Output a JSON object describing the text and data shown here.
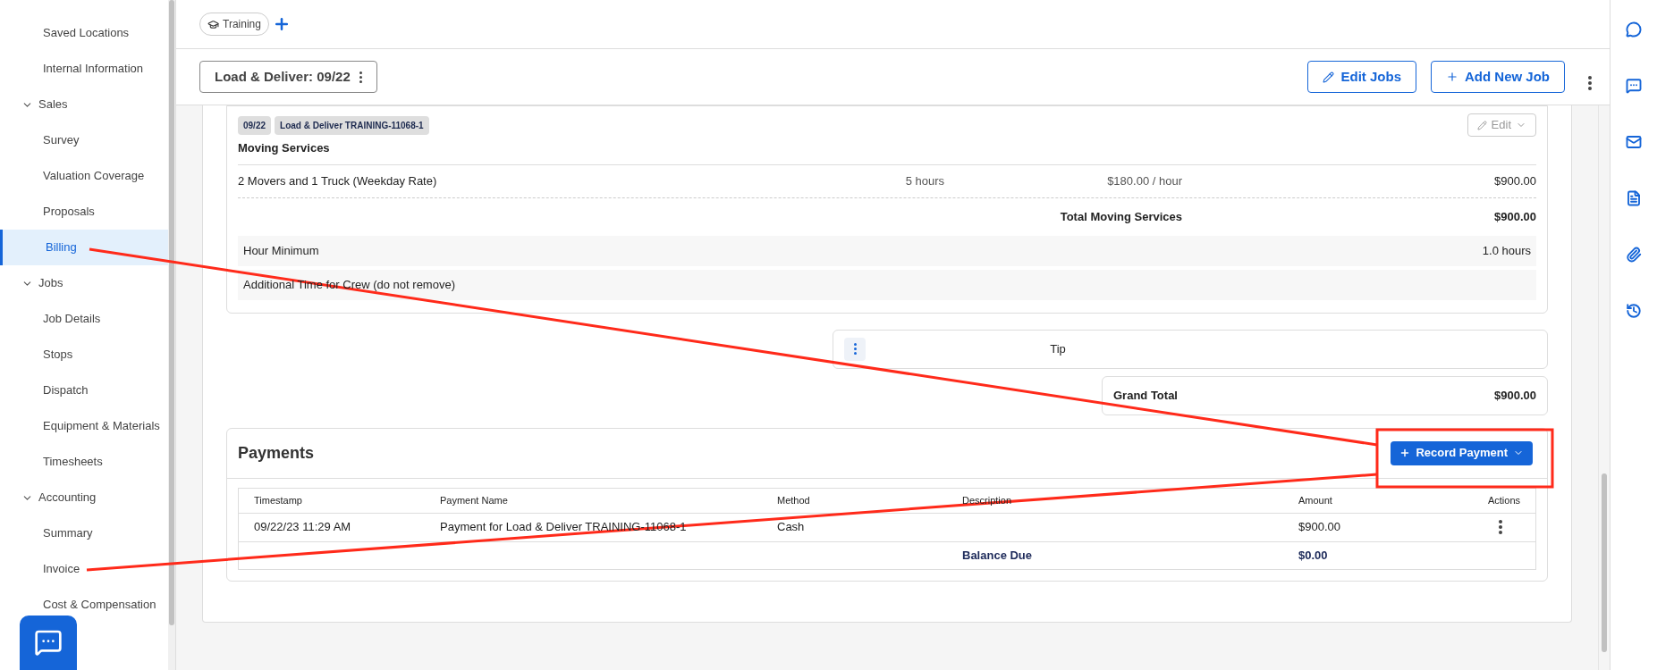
{
  "sidebar": {
    "items": [
      {
        "label": "Saved Locations",
        "selected": false
      },
      {
        "label": "Internal Information",
        "selected": false
      },
      {
        "label": "Sales",
        "expanded": true,
        "selected": false,
        "children": [
          {
            "label": "Survey",
            "selected": false
          },
          {
            "label": "Valuation Coverage",
            "selected": false
          },
          {
            "label": "Proposals",
            "selected": false
          },
          {
            "label": "Billing",
            "selected": true
          }
        ]
      },
      {
        "label": "Jobs",
        "expanded": true,
        "selected": false,
        "children": [
          {
            "label": "Job Details",
            "selected": false
          },
          {
            "label": "Stops",
            "selected": false
          },
          {
            "label": "Dispatch",
            "selected": false
          },
          {
            "label": "Equipment & Materials",
            "selected": false
          },
          {
            "label": "Timesheets",
            "selected": false
          }
        ]
      },
      {
        "label": "Accounting",
        "expanded": true,
        "selected": false,
        "children": [
          {
            "label": "Summary",
            "selected": false
          },
          {
            "label": "Invoice",
            "selected": false
          },
          {
            "label": "Cost & Compensation",
            "selected": false
          }
        ]
      }
    ]
  },
  "header": {
    "tags": [
      {
        "label": "Training"
      }
    ]
  },
  "job_bar": {
    "job_tab": "Load & Deliver: 09/22",
    "buttons": [
      {
        "kind": "edit",
        "label": "Edit Jobs"
      },
      {
        "kind": "add",
        "label": "Add New Job"
      }
    ]
  },
  "billing": {
    "badges": [
      "09/22",
      "Load & Deliver TRAINING-11068-1"
    ],
    "edit_button": "Edit",
    "section_title": "Moving Services",
    "line_items": [
      {
        "name": "2 Movers and 1 Truck (Weekday Rate)",
        "quantity": "5 hours",
        "rate": "$180.00 / hour",
        "amount": "$900.00"
      }
    ],
    "total": {
      "label": "Total Moving Services",
      "value": "$900.00"
    },
    "extras": [
      {
        "label": "Hour Minimum",
        "value": "1.0 hours"
      },
      {
        "label": "Additional Time for Crew (do not remove)"
      }
    ]
  },
  "tip": {
    "label": "Tip"
  },
  "grand_total": {
    "label": "Grand Total",
    "value": "$900.00"
  },
  "payments": {
    "title": "Payments",
    "record_button": "Record Payment",
    "columns": [
      "Timestamp",
      "Payment Name",
      "Method",
      "Description",
      "Amount",
      "Actions"
    ],
    "rows": [
      {
        "timestamp": "09/22/23 11:29 AM",
        "name": "Payment for Load & Deliver TRAINING-11068-1",
        "method": "Cash",
        "amount": "$900.00"
      }
    ],
    "balance": {
      "label": "Balance Due",
      "value": "$0.00"
    }
  }
}
